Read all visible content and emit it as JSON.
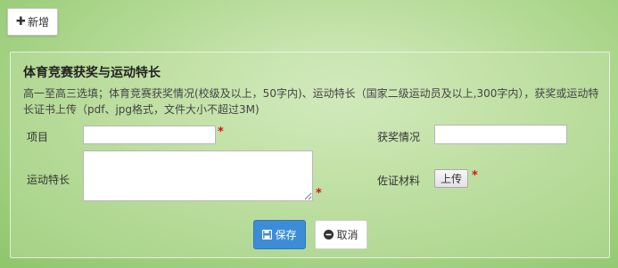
{
  "toolbar": {
    "add_label": "新增",
    "add_icon": "plus-icon"
  },
  "panel": {
    "title": "体育竞赛获奖与运动特长",
    "description": "高一至高三选填；体育竞赛获奖情况(校级及以上，50字内)、运动特长（国家二级运动员及以上,300字内），获奖或运动特长证书上传（pdf、jpg格式，文件大小不超过3M)"
  },
  "form": {
    "item_label": "项目",
    "item_value": "",
    "award_label": "获奖情况",
    "award_value": "",
    "specialty_label": "运动特长",
    "specialty_value": "",
    "evidence_label": "佐证材料",
    "upload_label": "上传",
    "required_mark": "*"
  },
  "actions": {
    "save_label": "保存",
    "save_icon": "save-icon",
    "cancel_label": "取消",
    "cancel_icon": "minus-circle-icon"
  },
  "colors": {
    "primary": "#3c8dd6",
    "required": "#d41414",
    "background": "#b9dd9c"
  }
}
